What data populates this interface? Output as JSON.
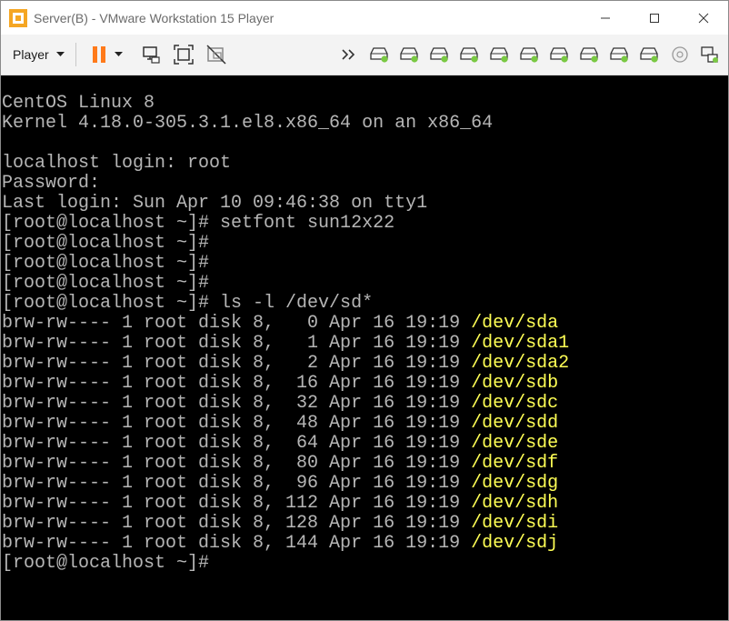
{
  "window": {
    "title": "Server(B) - VMware Workstation 15 Player"
  },
  "toolbar": {
    "player_label": "Player",
    "buttons": [
      "pause-icon",
      "dropdown-caret-icon",
      "send-ctrl-alt-del-icon",
      "fit-guest-icon",
      "unity-icon"
    ],
    "devices": [
      "more-devices-icon",
      "hard-disk-icon",
      "hard-disk-icon",
      "hard-disk-icon",
      "hard-disk-icon",
      "hard-disk-icon",
      "hard-disk-icon",
      "hard-disk-icon",
      "hard-disk-icon",
      "hard-disk-icon",
      "hard-disk-icon",
      "cd-dvd-icon",
      "network-adapter-icon"
    ]
  },
  "colors": {
    "accent_pause": "#ff7a1a",
    "disk_active": "#7ac943",
    "terminal_text": "#b6b6b6",
    "device_path": "#ffff55"
  },
  "terminal": {
    "header": [
      "CentOS Linux 8",
      "Kernel 4.18.0-305.3.1.el8.x86_64 on an x86_64",
      "",
      "localhost login: root",
      "Password:",
      "Last login: Sun Apr 10 09:46:38 on tty1",
      "[root@localhost ~]# setfont sun12x22",
      "[root@localhost ~]#",
      "[root@localhost ~]#",
      "[root@localhost ~]#",
      "[root@localhost ~]# ls -l /dev/sd*"
    ],
    "listing": [
      {
        "meta": "brw-rw---- 1 root disk 8,   0 Apr 16 19:19 ",
        "path": "/dev/sda"
      },
      {
        "meta": "brw-rw---- 1 root disk 8,   1 Apr 16 19:19 ",
        "path": "/dev/sda1"
      },
      {
        "meta": "brw-rw---- 1 root disk 8,   2 Apr 16 19:19 ",
        "path": "/dev/sda2"
      },
      {
        "meta": "brw-rw---- 1 root disk 8,  16 Apr 16 19:19 ",
        "path": "/dev/sdb"
      },
      {
        "meta": "brw-rw---- 1 root disk 8,  32 Apr 16 19:19 ",
        "path": "/dev/sdc"
      },
      {
        "meta": "brw-rw---- 1 root disk 8,  48 Apr 16 19:19 ",
        "path": "/dev/sdd"
      },
      {
        "meta": "brw-rw---- 1 root disk 8,  64 Apr 16 19:19 ",
        "path": "/dev/sde"
      },
      {
        "meta": "brw-rw---- 1 root disk 8,  80 Apr 16 19:19 ",
        "path": "/dev/sdf"
      },
      {
        "meta": "brw-rw---- 1 root disk 8,  96 Apr 16 19:19 ",
        "path": "/dev/sdg"
      },
      {
        "meta": "brw-rw---- 1 root disk 8, 112 Apr 16 19:19 ",
        "path": "/dev/sdh"
      },
      {
        "meta": "brw-rw---- 1 root disk 8, 128 Apr 16 19:19 ",
        "path": "/dev/sdi"
      },
      {
        "meta": "brw-rw---- 1 root disk 8, 144 Apr 16 19:19 ",
        "path": "/dev/sdj"
      }
    ],
    "prompt": "[root@localhost ~]#"
  }
}
